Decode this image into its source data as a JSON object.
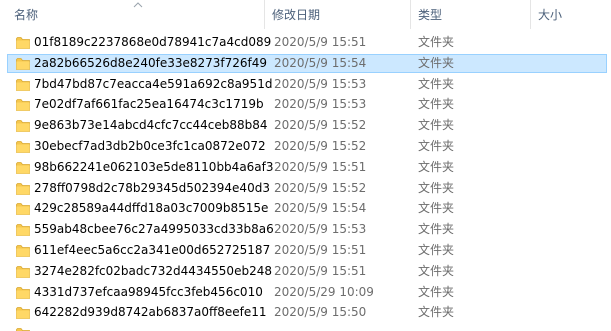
{
  "columns": {
    "name": "名称",
    "date": "修改日期",
    "type": "类型",
    "size": "大小"
  },
  "colors": {
    "selected_bg": "#cce8ff",
    "selected_border": "#99d1ff",
    "header_text": "#4c607a",
    "secondary_text": "#6d6d6d",
    "folder_yellow": "#f6c74d"
  },
  "files": [
    {
      "name": "01f8189c2237868e0d78941c7a4cd089",
      "date": "2020/5/9 15:51",
      "type": "文件夹",
      "selected": false
    },
    {
      "name": "2a82b66526d8e240fe33e8273f726f49",
      "date": "2020/5/9 15:54",
      "type": "文件夹",
      "selected": true
    },
    {
      "name": "7bd47bd87c7eacca4e591a692c8a951d",
      "date": "2020/5/9 15:53",
      "type": "文件夹",
      "selected": false
    },
    {
      "name": "7e02df7af661fac25ea16474c3c1719b",
      "date": "2020/5/9 15:53",
      "type": "文件夹",
      "selected": false
    },
    {
      "name": "9e863b73e14abcd4cfc7cc44ceb88b84",
      "date": "2020/5/9 15:52",
      "type": "文件夹",
      "selected": false
    },
    {
      "name": "30ebecf7ad3db2b0ce3fc1ca0872e072",
      "date": "2020/5/9 15:52",
      "type": "文件夹",
      "selected": false
    },
    {
      "name": "98b662241e062103e5de8110bb4a6af3",
      "date": "2020/5/9 15:51",
      "type": "文件夹",
      "selected": false
    },
    {
      "name": "278ff0798d2c78b29345d502394e40d3",
      "date": "2020/5/9 15:52",
      "type": "文件夹",
      "selected": false
    },
    {
      "name": "429c28589a44dffd18a03c7009b8515e",
      "date": "2020/5/9 15:54",
      "type": "文件夹",
      "selected": false
    },
    {
      "name": "559ab48cbee76c27a4995033cd33b8a6",
      "date": "2020/5/9 15:53",
      "type": "文件夹",
      "selected": false
    },
    {
      "name": "611ef4eec5a6cc2a341e00d652725187",
      "date": "2020/5/9 15:51",
      "type": "文件夹",
      "selected": false
    },
    {
      "name": "3274e282fc02badc732d4434550eb248",
      "date": "2020/5/9 15:51",
      "type": "文件夹",
      "selected": false
    },
    {
      "name": "4331d737efcaa98945fcc3feb456c010",
      "date": "2020/5/29 10:09",
      "type": "文件夹",
      "selected": false
    },
    {
      "name": "642282d939d8742ab6837a0ff8eefe11",
      "date": "2020/5/9 15:50",
      "type": "文件夹",
      "selected": false
    },
    {
      "name": "",
      "date": "",
      "type": "",
      "selected": false
    }
  ]
}
